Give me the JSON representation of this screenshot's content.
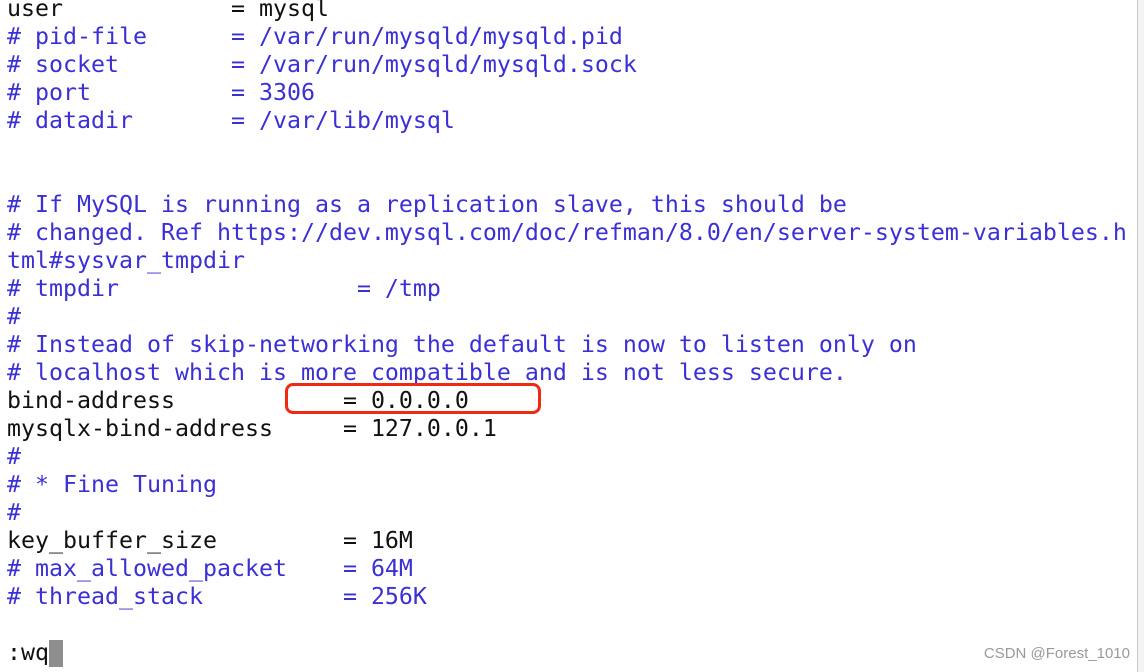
{
  "editor": {
    "lines": [
      {
        "text": "user            = mysql",
        "type": "setting"
      },
      {
        "text": "# pid-file      = /var/run/mysqld/mysqld.pid",
        "type": "comment"
      },
      {
        "text": "# socket        = /var/run/mysqld/mysqld.sock",
        "type": "comment"
      },
      {
        "text": "# port          = 3306",
        "type": "comment"
      },
      {
        "text": "# datadir       = /var/lib/mysql",
        "type": "comment"
      },
      {
        "text": "",
        "type": "blank"
      },
      {
        "text": "",
        "type": "blank"
      },
      {
        "text": "# If MySQL is running as a replication slave, this should be",
        "type": "comment"
      },
      {
        "text": "# changed. Ref https://dev.mysql.com/doc/refman/8.0/en/server-system-variables.h",
        "type": "comment"
      },
      {
        "text": "tml#sysvar_tmpdir",
        "type": "comment"
      },
      {
        "text": "# tmpdir                 = /tmp",
        "type": "comment"
      },
      {
        "text": "#",
        "type": "comment"
      },
      {
        "text": "# Instead of skip-networking the default is now to listen only on",
        "type": "comment"
      },
      {
        "text": "# localhost which is more compatible and is not less secure.",
        "type": "comment"
      },
      {
        "text": "bind-address            = 0.0.0.0",
        "type": "setting"
      },
      {
        "text": "mysqlx-bind-address     = 127.0.0.1",
        "type": "setting"
      },
      {
        "text": "#",
        "type": "comment"
      },
      {
        "text": "# * Fine Tuning",
        "type": "comment"
      },
      {
        "text": "#",
        "type": "comment"
      },
      {
        "text": "key_buffer_size         = 16M",
        "type": "setting"
      },
      {
        "text": "# max_allowed_packet    = 64M",
        "type": "comment"
      },
      {
        "text": "# thread_stack          = 256K",
        "type": "comment"
      }
    ],
    "command": ":wq",
    "highlight_color": "#f02a12",
    "comment_color": "#3b2fd6"
  },
  "watermark": "CSDN @Forest_1010"
}
